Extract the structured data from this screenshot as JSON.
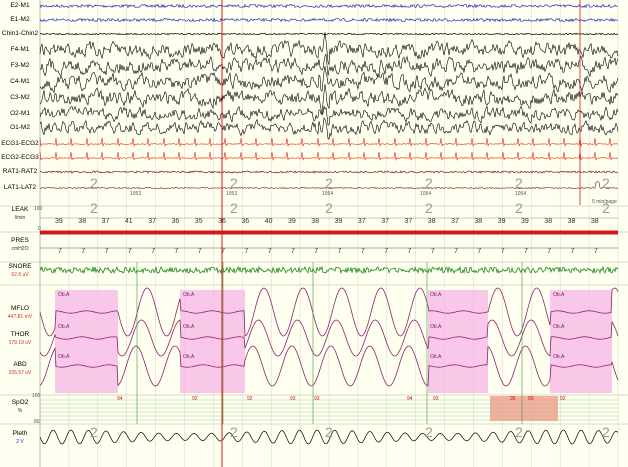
{
  "channels": [
    {
      "id": "E2-M1",
      "label": "E2-M1",
      "color": "#1c2dbf"
    },
    {
      "id": "E1-M2",
      "label": "E1-M2",
      "color": "#1c2dbf"
    },
    {
      "id": "Chin1-Chin2",
      "label": "Chin1-Chin2",
      "color": "#000000"
    },
    {
      "id": "F4-M1",
      "label": "F4-M1",
      "color": "#000000"
    },
    {
      "id": "F3-M2",
      "label": "F3-M2",
      "color": "#000000"
    },
    {
      "id": "C4-M1",
      "label": "C4-M1",
      "color": "#000000"
    },
    {
      "id": "C3-M2",
      "label": "C3-M2",
      "color": "#000000"
    },
    {
      "id": "O2-M1",
      "label": "O2-M1",
      "color": "#000000"
    },
    {
      "id": "O1-M2",
      "label": "O1-M2",
      "color": "#000000"
    },
    {
      "id": "ECG1-ECG2",
      "label": "ECG1-ECG2",
      "color": "#e8200f"
    },
    {
      "id": "ECG2-ECG3",
      "label": "ECG2-ECG3",
      "color": "#e8200f"
    },
    {
      "id": "RAT1-RAT2",
      "label": "RAT1-RAT2",
      "color": "#7a1a1a"
    },
    {
      "id": "LAT1-LAT2",
      "label": "LAT1-LAT2",
      "color": "#7a1a1a"
    },
    {
      "id": "LEAK",
      "label": "LEAK",
      "unit": "l/min",
      "color": "#000000"
    },
    {
      "id": "PRES",
      "label": "PRES",
      "unit": "cmH2O",
      "color": "#000000"
    },
    {
      "id": "SNORE",
      "label": "SNORE",
      "unit": "62.6 uV",
      "unit_color": "#d3322a",
      "color": "#1f8a1f"
    },
    {
      "id": "MFLO",
      "label": "MFLO",
      "unit": "447.81 mV",
      "unit_color": "#d3322a",
      "color": "#8b2570"
    },
    {
      "id": "THOR",
      "label": "THOR",
      "unit": "179.19 uV",
      "unit_color": "#d3322a",
      "color": "#8b2570"
    },
    {
      "id": "ABD",
      "label": "ABD",
      "unit": "335.57 uV",
      "unit_color": "#d3322a",
      "color": "#8b2570"
    },
    {
      "id": "SpO2",
      "label": "SpO2",
      "unit": "%",
      "color": "#000000"
    },
    {
      "id": "Pleth",
      "label": "Pleth",
      "unit": "2 V",
      "unit_color": "#2233cc",
      "color": "#000000"
    }
  ],
  "epoch_markers": [
    "1053",
    "1053",
    "1054",
    "1054",
    "1054"
  ],
  "page_scale": "5 min/page",
  "leak_axis": {
    "top": "100",
    "bottom": "0"
  },
  "leak_values": [
    "39",
    "38",
    "37",
    "41",
    "37",
    "36",
    "35",
    "36",
    "36",
    "40",
    "39",
    "38",
    "39",
    "37",
    "37",
    "37",
    "38",
    "37",
    "38",
    "39",
    "39",
    "38",
    "38",
    "38"
  ],
  "pres_values": [
    "7",
    "7",
    "7",
    "7",
    "7",
    "7",
    "7",
    "7",
    "7",
    "7",
    "7",
    "7",
    "7",
    "7",
    "7",
    "7",
    "7",
    "7",
    "7",
    "7",
    "7",
    "7",
    "7",
    "7"
  ],
  "spo2_axis": {
    "top": "100",
    "bottom": "80"
  },
  "spo2_values": [
    "94",
    "92",
    "92",
    "93",
    "93",
    "94",
    "93",
    "95",
    "93",
    "92"
  ],
  "event_labels": [
    "Ob.A",
    "Ob.A",
    "Ob.A",
    "Ob.A",
    "Ob.A",
    "Ob.A",
    "Ob.A",
    "Ob.A",
    "Ob.A",
    "Ob.A",
    "Ob.A",
    "Ob.A"
  ],
  "colors": {
    "background": "#fffff0",
    "apnea": "#f7b6e6",
    "desat": "#f49b8b",
    "cursor": "#d31818",
    "pres_bar": "#d31818",
    "stage_marker": "#9a9a9a",
    "grid": "#c9c9c9"
  }
}
